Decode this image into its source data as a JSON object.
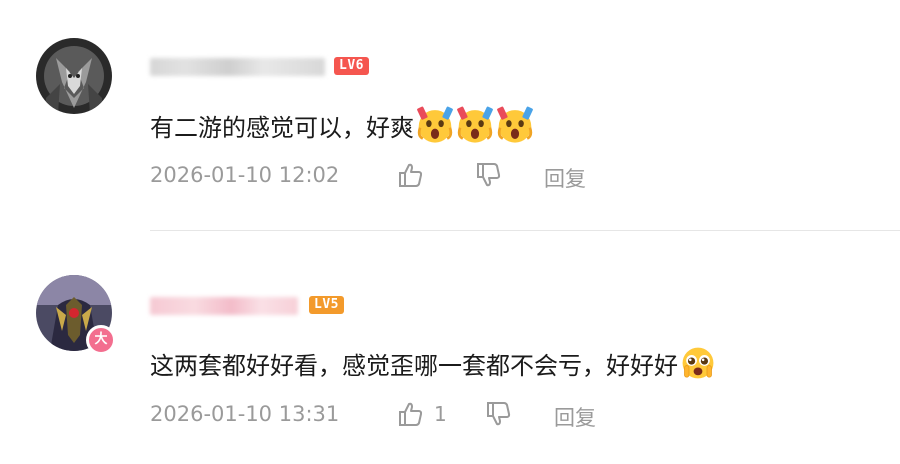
{
  "comments": [
    {
      "level": "LV6",
      "text": "有二游的感觉可以，好爽",
      "emojis": [
        "screaming-face-emoji",
        "screaming-face-emoji",
        "screaming-face-emoji"
      ],
      "timestamp": "2026-01-10 12:02",
      "likes": "",
      "reply_label": "回复"
    },
    {
      "level": "LV5",
      "badge": "大",
      "text": "这两套都好好看，感觉歪哪一套都不会亏，好好好",
      "emojis": [
        "pleading-face-emoji"
      ],
      "timestamp": "2026-01-10 13:31",
      "likes": "1",
      "reply_label": "回复"
    }
  ],
  "colors": {
    "level6": "#f5564f",
    "level5": "#f39a2b",
    "badge": "#f36e8f",
    "meta_gray": "#9a9a9a"
  }
}
